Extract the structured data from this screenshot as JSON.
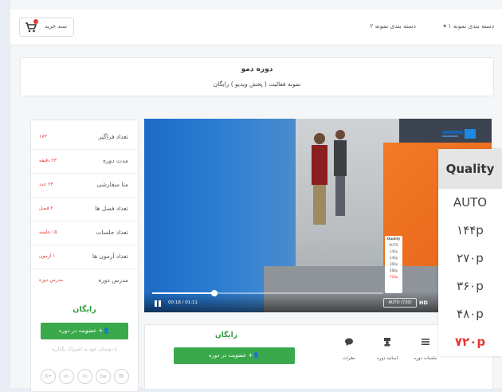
{
  "header": {
    "nav": [
      {
        "label": "دسته بندی نمونه ۱"
      },
      {
        "label": "دسته بندی نمونه ۲"
      }
    ],
    "cart_label": "سبد خرید"
  },
  "course": {
    "title": "دوره دمو",
    "subtitle": "نمونه فعالیت ( پخش ویدیو ) رایگان"
  },
  "info": {
    "rows": [
      {
        "label": "تعداد فراگیر",
        "value": "۱۷۳"
      },
      {
        "label": "مدت دوره",
        "value": "۲۳ دقیقه"
      },
      {
        "label": "متا سفارشی",
        "value": "۲۳ عدد"
      },
      {
        "label": "تعداد فصل ها",
        "value": "۲ فصل"
      },
      {
        "label": "تعداد جلسات",
        "value": "۱۵ جلسه"
      },
      {
        "label": "تعداد آزمون ها",
        "value": "۱ آزمون"
      },
      {
        "label": "مدرس دوره",
        "value": "مدرس دوره"
      }
    ],
    "price": "رایگان",
    "join_label": "عضویت در دوره",
    "share_text": "با دوستان خود به اشتراک بگذارید",
    "socials": [
      "G+",
      "in",
      "in",
      "tw",
      "fb"
    ]
  },
  "video": {
    "time": "00:18 / 01:11",
    "progress": 0.27,
    "auto_label": "AUTO (720)",
    "hd_label": "HD",
    "mini_menu": [
      "Quality",
      "AUTO",
      "144p",
      "240p",
      "360p",
      "480p",
      "720p"
    ],
    "quality_title": "Quality",
    "quality_options": [
      "AUTO",
      "۱۴۴p",
      "۲۷۰p",
      "۳۶۰p",
      "۴۸۰p",
      "۷۲۰p"
    ],
    "quality_selected": 5
  },
  "bottom": {
    "price": "رایگان",
    "join_label": "عضویت در دوره",
    "tabs": [
      {
        "label": "جلسات دوره",
        "icon": "list-icon"
      },
      {
        "label": "اساتید دوره",
        "icon": "teacher-icon"
      },
      {
        "label": "نظرات",
        "icon": "comment-icon"
      }
    ]
  },
  "colors": {
    "accent_green": "#3aa94b",
    "accent_red": "#e53935"
  }
}
